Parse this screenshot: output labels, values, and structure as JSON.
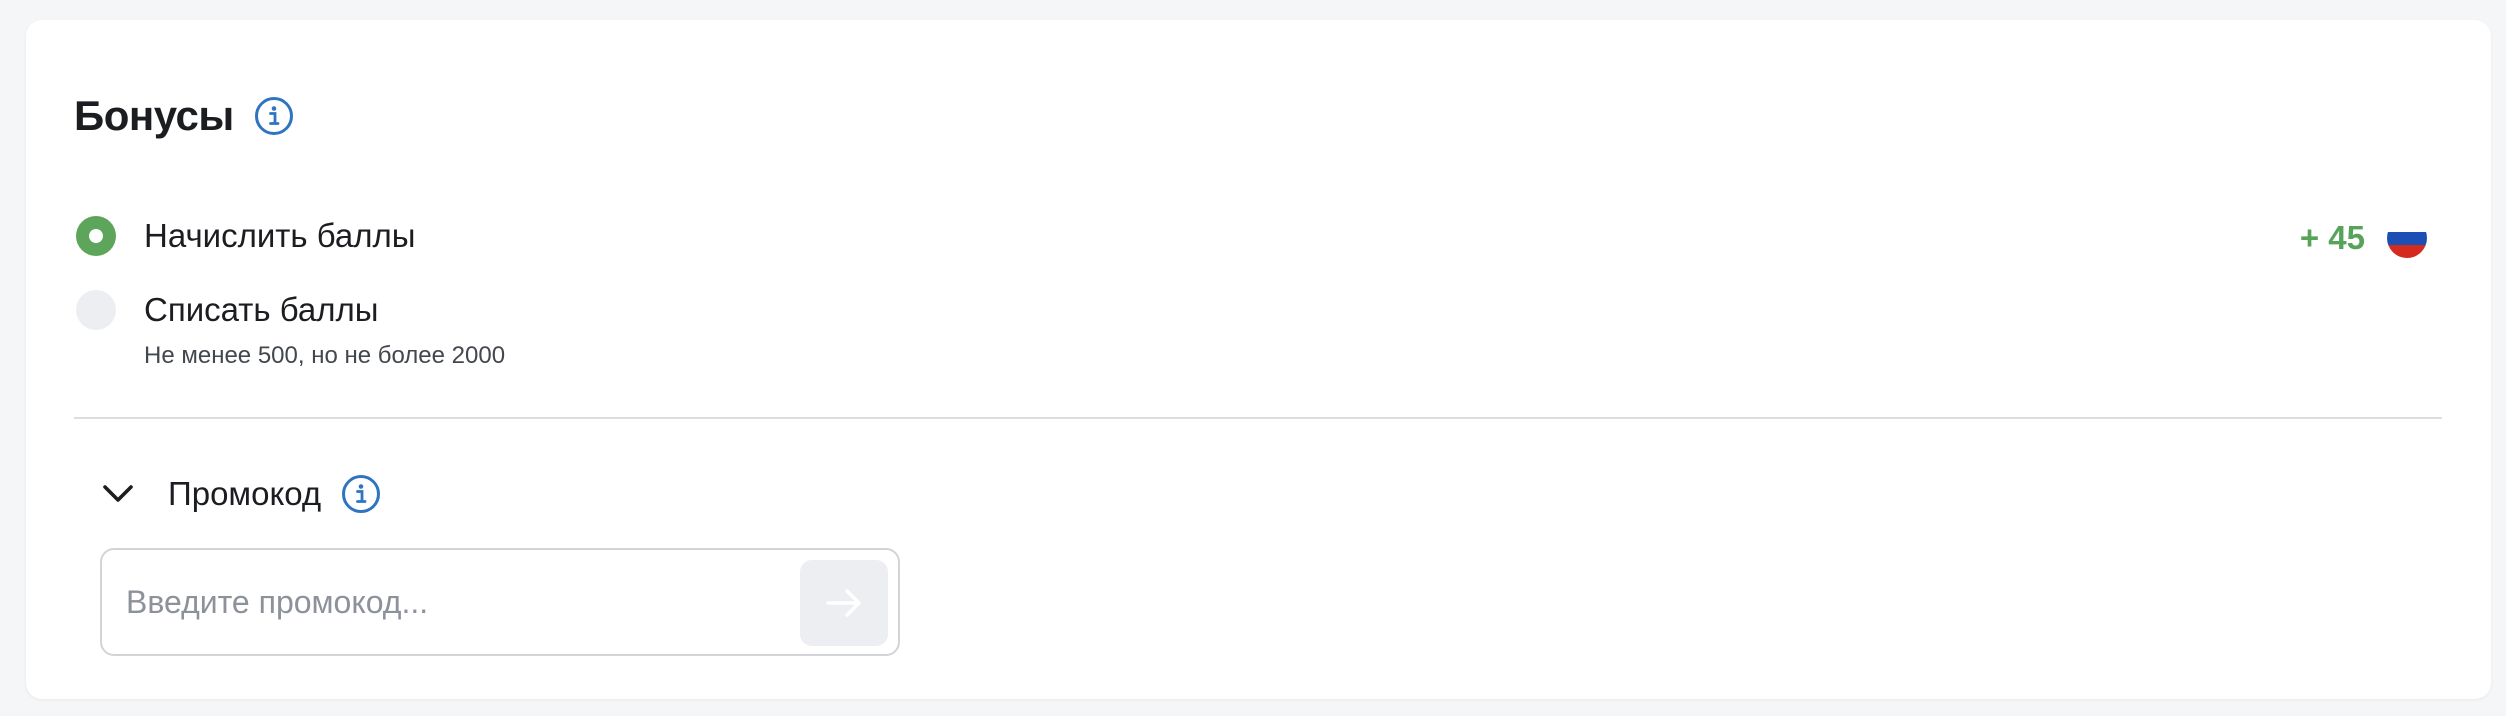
{
  "bonuses": {
    "title": "Бонусы",
    "options": [
      {
        "label": "Начислить баллы",
        "selected": true,
        "value": "+ 45"
      },
      {
        "label": "Списать баллы",
        "selected": false,
        "hint": "Не менее 500, но не более 2000"
      }
    ]
  },
  "promo": {
    "label": "Промокод",
    "placeholder": "Введите промокод...",
    "value": ""
  },
  "colors": {
    "accent_green": "#5ca55a",
    "info_blue": "#2f74c0",
    "text": "#1b1d21"
  },
  "icons": [
    "info-icon",
    "chevron-down-icon",
    "arrow-right-icon",
    "russian-flag-icon"
  ]
}
